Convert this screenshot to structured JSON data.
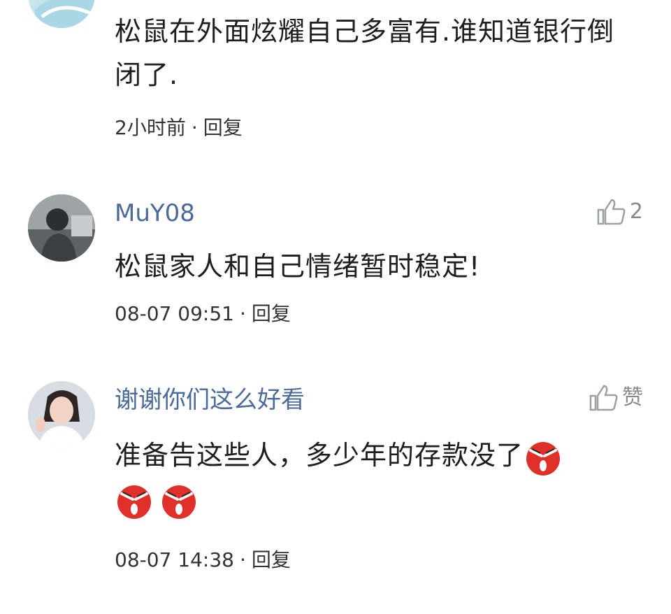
{
  "comments": [
    {
      "text": "松鼠在外面炫耀自己多富有.谁知道银行倒闭了.",
      "time": "2小时前",
      "reply_label": "回复"
    },
    {
      "username": "MuY08",
      "likes": "2",
      "text": "松鼠家人和自己情绪暂时稳定!",
      "time": "08-07 09:51",
      "reply_label": "回复"
    },
    {
      "username": "谢谢你们这么好看",
      "likes": "赞",
      "text": "准备告这些人，多少年的存款没了",
      "time": "08-07 14:38",
      "reply_label": "回复",
      "emoji_icon": "angry-face-icon"
    }
  ],
  "colors": {
    "username": "#4a6a9a",
    "text": "#1e1e1e",
    "meta": "#333333",
    "like": "#8a8a8a",
    "emoji_red": "#e0302a"
  }
}
